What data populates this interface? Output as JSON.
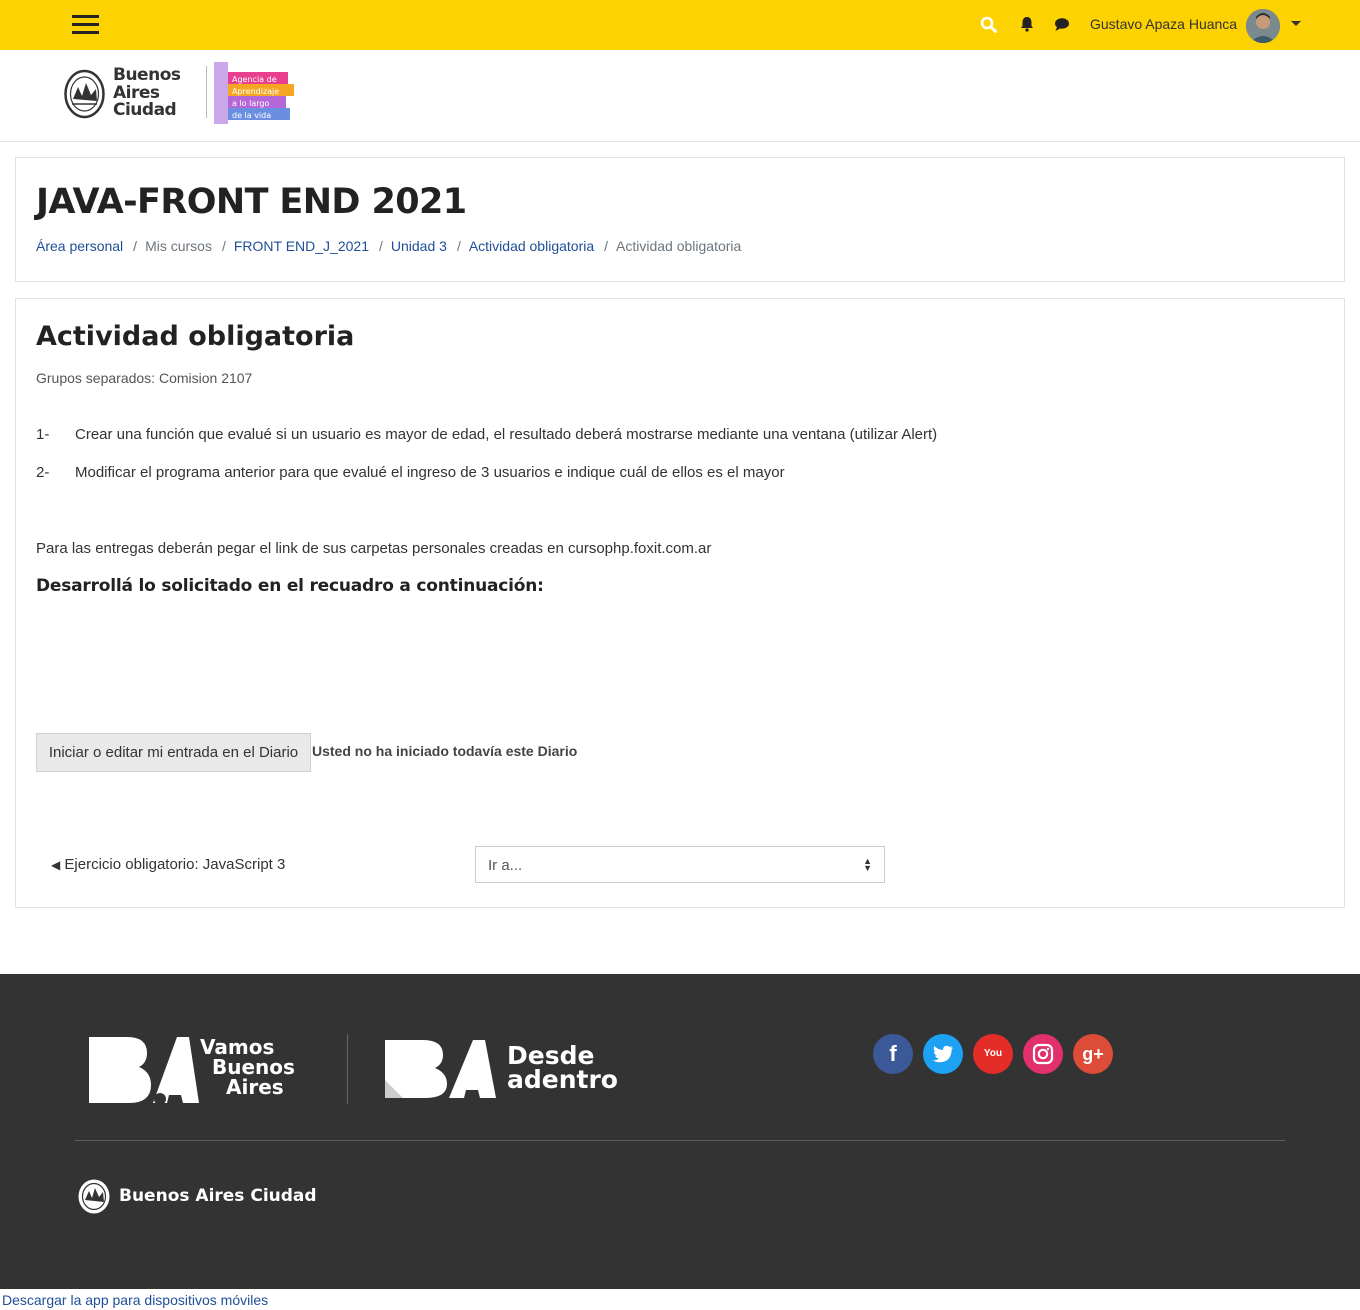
{
  "navbar": {
    "user_name": "Gustavo Apaza Huanca",
    "accent_color": "#fcd200"
  },
  "header_logos": {
    "ba_wordmark": [
      "Buenos",
      "Aires",
      "Ciudad"
    ],
    "agency_lines": [
      "Agencia de",
      "Aprendizaje",
      "a lo largo",
      "de la vida"
    ]
  },
  "course": {
    "title": "JAVA-FRONT END 2021",
    "breadcrumb": [
      {
        "label": "Área personal",
        "link": true
      },
      {
        "label": "Mis cursos",
        "link": false
      },
      {
        "label": "FRONT END_J_2021",
        "link": true
      },
      {
        "label": "Unidad 3",
        "link": true
      },
      {
        "label": "Actividad obligatoria",
        "link": true
      },
      {
        "label": "Actividad obligatoria",
        "link": false
      }
    ]
  },
  "activity": {
    "title": "Actividad obligatoria",
    "groups": "Grupos separados: Comision 2107",
    "items": [
      {
        "num": "1-",
        "text": "Crear una función que evalué si un usuario es mayor de edad, el resultado deberá mostrarse mediante una ventana (utilizar Alert)"
      },
      {
        "num": "2-",
        "text": "Modificar el programa anterior para que evalué el ingreso de 3 usuarios e indique cuál de ellos es el mayor"
      }
    ],
    "paragraph": "Para las entregas deberán pegar el link de sus carpetas personales creadas en cursophp.foxit.com.ar",
    "instruction": "Desarrollá lo solicitado en el recuadro a continuación:",
    "diary_button": "Iniciar o editar mi entrada en el Diario",
    "diary_status": "Usted no ha iniciado todavía este Diario",
    "prev_activity": "Ejercicio obligatorio: JavaScript 3",
    "jump_placeholder": "Ir a..."
  },
  "footer": {
    "vamos": [
      "Vamos",
      "Buenos",
      "Aires"
    ],
    "desde": [
      "Desde",
      "adentro"
    ],
    "city": "Buenos Aires Ciudad",
    "social": [
      {
        "name": "facebook",
        "glyph": "f",
        "color": "#3b5998"
      },
      {
        "name": "twitter",
        "glyph": "t",
        "color": "#1da1f2"
      },
      {
        "name": "youtube",
        "glyph": "You",
        "color": "#e52d27"
      },
      {
        "name": "instagram",
        "glyph": "ig",
        "color": "#e1306c"
      },
      {
        "name": "google-plus",
        "glyph": "g+",
        "color": "#dd4b39"
      }
    ]
  },
  "app_link": "Descargar la app para dispositivos móviles"
}
